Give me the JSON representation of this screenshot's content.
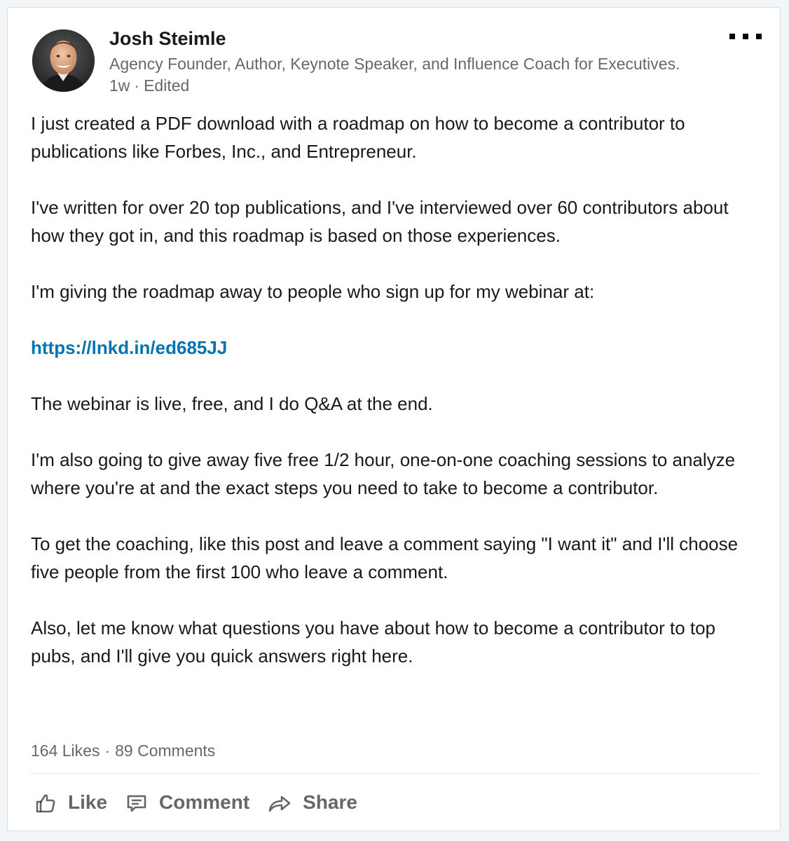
{
  "author": {
    "name": "Josh Steimle",
    "headline": "Agency Founder, Author, Keynote Speaker, and Influence Coach for Executives.",
    "time": "1w",
    "edited": "Edited"
  },
  "post": {
    "paragraphs": [
      "I just created a PDF download with a roadmap on how to become a contributor to publications like Forbes, Inc., and Entrepreneur.",
      "I've written for over 20 top publications, and I've interviewed over 60 contributors about how they got in, and this roadmap is based on those experiences.",
      "I'm giving the roadmap away to people who sign up for my webinar at:",
      "The webinar is live, free, and I do Q&A at the end.",
      "I'm also going to give away five free 1/2 hour, one-on-one coaching sessions to analyze where you're at and the exact steps you need to take to become a contributor.",
      "To get the coaching, like this post and leave a comment saying \"I want it\" and I'll choose five people from the first 100 who leave a comment.",
      "Also, let me know what questions you have about how to become a contributor to top pubs, and I'll give you quick answers right here."
    ],
    "link": "https://lnkd.in/ed685JJ"
  },
  "social": {
    "likes": "164 Likes",
    "comments": "89 Comments"
  },
  "actions": {
    "like": "Like",
    "comment": "Comment",
    "share": "Share"
  },
  "icons": {
    "like": "thumbs-up-icon",
    "comment": "comment-icon",
    "share": "share-arrow-icon",
    "more": "more-options-icon"
  },
  "colors": {
    "link": "#0073b1",
    "muted_text": "#666666",
    "card_background": "#ffffff",
    "page_background": "#f3f6f8"
  }
}
